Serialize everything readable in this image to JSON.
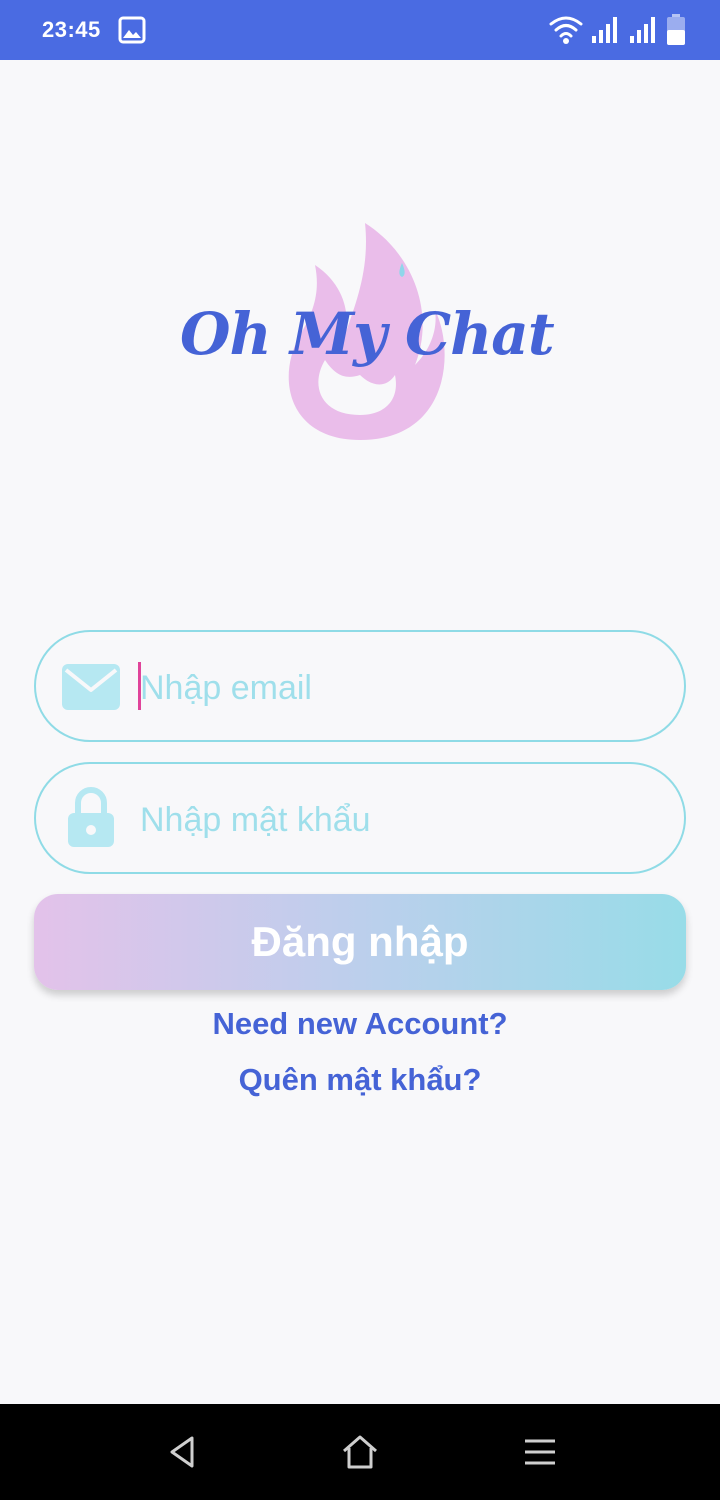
{
  "status_bar": {
    "time": "23:45",
    "icons": [
      "gallery-icon",
      "wifi-icon",
      "signal-icon",
      "signal-icon",
      "battery-icon"
    ],
    "background": "#4a6be2"
  },
  "logo": {
    "text": "Oh My Chat",
    "flame_color": "#e8b6e8",
    "text_color": "#4563d6"
  },
  "form": {
    "email_placeholder": "Nhập email",
    "password_placeholder": "Nhập mật khẩu",
    "login_label": "Đăng nhập",
    "field_border_color": "#8fdbe6"
  },
  "links": {
    "new_account": "Need new Account?",
    "forgot_password": "Quên mật khẩu?"
  },
  "nav_bar": {
    "buttons": [
      "back-icon",
      "home-icon",
      "menu-icon"
    ]
  }
}
